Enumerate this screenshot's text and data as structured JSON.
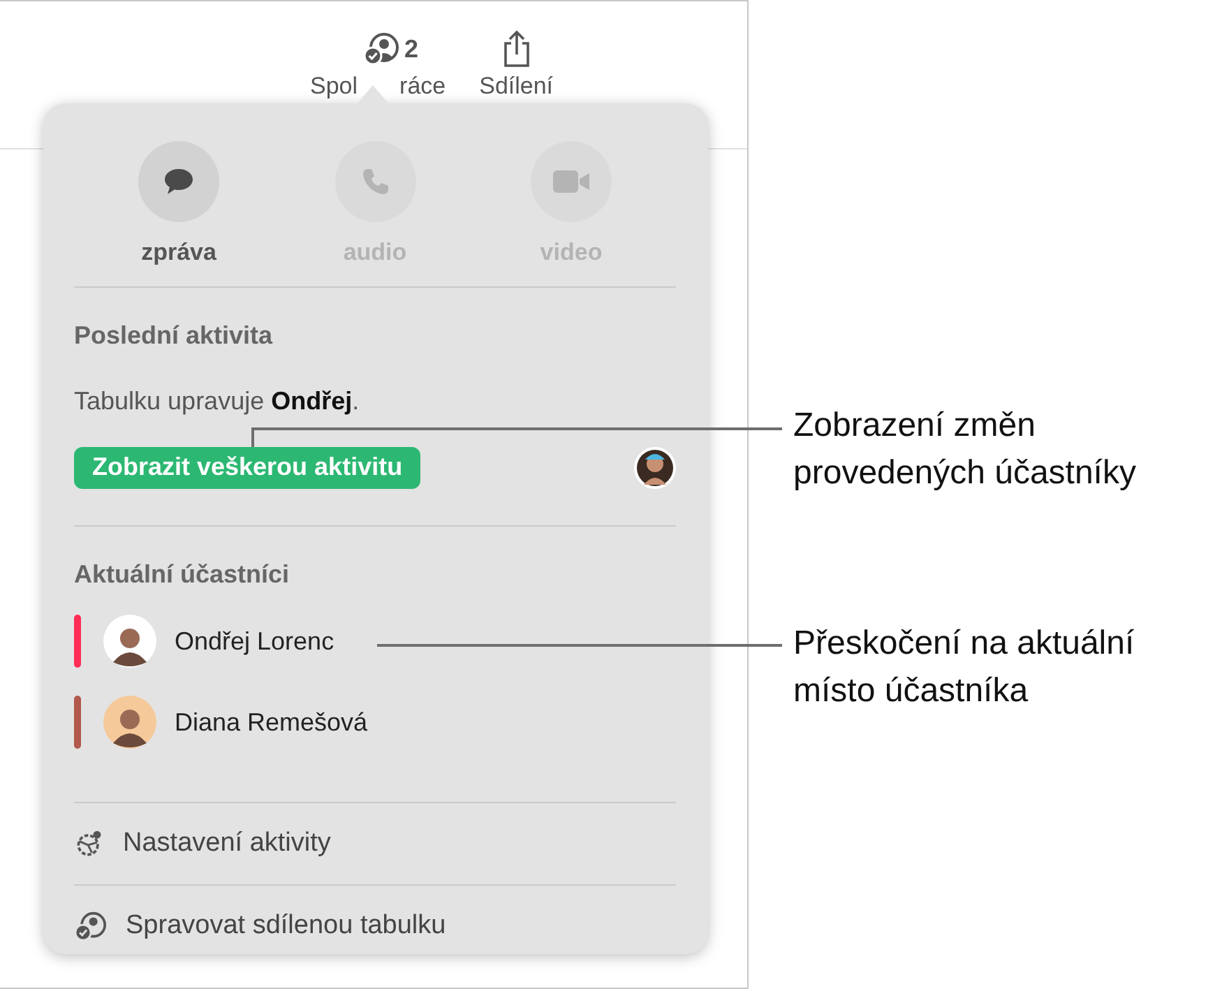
{
  "toolbar": {
    "collaborate": {
      "count": "2",
      "label_parts": [
        "Spol",
        "ráce"
      ]
    },
    "share": {
      "label": "Sdílení"
    }
  },
  "popover": {
    "actions": [
      {
        "kind": "message",
        "label": "zpráva",
        "disabled": false
      },
      {
        "kind": "audio",
        "label": "audio",
        "disabled": true
      },
      {
        "kind": "video",
        "label": "video",
        "disabled": true
      }
    ],
    "recent_activity": {
      "heading": "Poslední aktivita",
      "text": "Tabulku upravuje **Ondřej**.",
      "button": "Zobrazit veškerou aktivitu"
    },
    "participants": {
      "heading": "Aktuální účastníci",
      "items": [
        {
          "name": "Ondřej Lorenc",
          "color": "#ff2d55"
        },
        {
          "name": "Diana Remešová",
          "color": "#b0594c"
        }
      ]
    },
    "menu": [
      {
        "kind": "settings",
        "label": "Nastavení aktivity"
      },
      {
        "kind": "manage",
        "label": "Spravovat sdílenou tabulku"
      }
    ]
  },
  "callouts": [
    "Zobrazení změn\nprovedených účastníky",
    "Přeskočení na aktuální\nmísto účastníka"
  ]
}
